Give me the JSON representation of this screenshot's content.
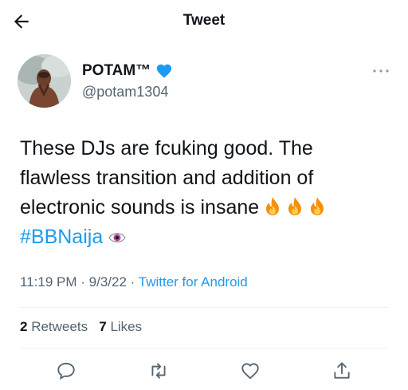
{
  "header": {
    "title": "Tweet",
    "back_icon": "arrow-left-icon"
  },
  "author": {
    "name": "POTAM™",
    "handle": "@potam1304",
    "verified_icon": "blue-heart-icon",
    "verified_color": "#1d9bf0"
  },
  "tweet": {
    "text_line1": "These DJs are fcuking good. The",
    "text_line2": "flawless transition and addition of",
    "text_line3": "electronic sounds is insane",
    "fire_emojis": [
      "🔥",
      "🔥",
      "🔥"
    ],
    "hashtag": "#BBNaija",
    "hashtag_emoji": "👁",
    "time": "11:19 PM",
    "date": "9/3/22",
    "separator": "·",
    "source": "Twitter for Android"
  },
  "stats": {
    "retweets_count": "2",
    "retweets_label": "Retweets",
    "likes_count": "7",
    "likes_label": "Likes"
  },
  "actions": [
    "reply-icon",
    "retweet-icon",
    "like-icon",
    "share-icon"
  ],
  "colors": {
    "link": "#1d9bf0",
    "secondary_text": "#536471",
    "primary_text": "#0f1419"
  }
}
